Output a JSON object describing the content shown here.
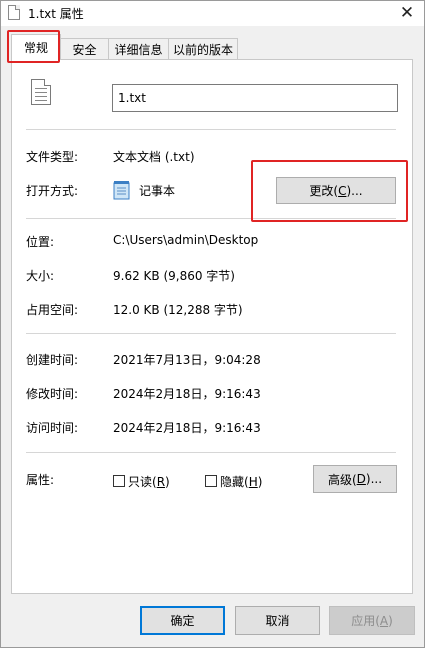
{
  "window": {
    "title": "1.txt 属性",
    "close_glyph": "✕"
  },
  "tabs": [
    {
      "label": "常规"
    },
    {
      "label": "安全"
    },
    {
      "label": "详细信息"
    },
    {
      "label": "以前的版本"
    }
  ],
  "general": {
    "file_name": "1.txt",
    "file_type": {
      "label": "文件类型:",
      "value": "文本文档 (.txt)"
    },
    "opens_with": {
      "label": "打开方式:",
      "app_name": "记事本",
      "change_button": {
        "text": "更改(",
        "hotkey": "C",
        "suffix": ")..."
      }
    },
    "location": {
      "label": "位置:",
      "value": "C:\\Users\\admin\\Desktop"
    },
    "size": {
      "label": "大小:",
      "value": "9.62 KB (9,860 字节)"
    },
    "size_on_disk": {
      "label": "占用空间:",
      "value": "12.0 KB (12,288 字节)"
    },
    "created": {
      "label": "创建时间:",
      "value": "2021年7月13日，9:04:28"
    },
    "modified": {
      "label": "修改时间:",
      "value": "2024年2月18日，9:16:43"
    },
    "accessed": {
      "label": "访问时间:",
      "value": "2024年2月18日，9:16:43"
    },
    "attributes": {
      "label": "属性:",
      "readonly": {
        "text": "只读(",
        "hotkey": "R",
        "suffix": ")",
        "checked": false
      },
      "hidden": {
        "text": "隐藏(",
        "hotkey": "H",
        "suffix": ")",
        "checked": false
      },
      "advanced_button": {
        "text": "高级(",
        "hotkey": "D",
        "suffix": ")..."
      }
    }
  },
  "footer": {
    "ok": "确定",
    "cancel": "取消",
    "apply": {
      "text": "应用(",
      "hotkey": "A",
      "suffix": ")"
    }
  },
  "colors": {
    "highlight": "#e02424",
    "primary_border": "#0078d7"
  }
}
